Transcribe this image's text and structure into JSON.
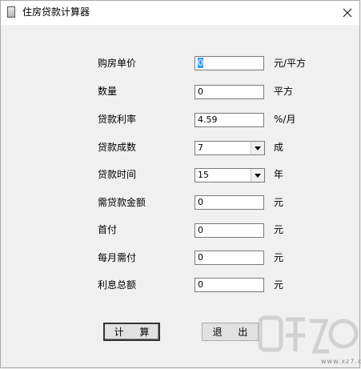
{
  "window": {
    "title": "住房贷款计算器"
  },
  "form": {
    "price": {
      "label": "购房单价",
      "value": "0",
      "unit": "元/平方"
    },
    "quantity": {
      "label": "数量",
      "value": "0",
      "unit": "平方"
    },
    "rate": {
      "label": "贷款利率",
      "value": "4.59",
      "unit": "%/月"
    },
    "ratio": {
      "label": "贷款成数",
      "selected": "7",
      "unit": "成"
    },
    "term": {
      "label": "贷款时间",
      "selected": "15",
      "unit": "年"
    },
    "loan_amount": {
      "label": "需贷款金额",
      "value": "0",
      "unit": "元"
    },
    "down_payment": {
      "label": "首付",
      "value": "0",
      "unit": "元"
    },
    "monthly": {
      "label": "每月需付",
      "value": "0",
      "unit": "元"
    },
    "interest": {
      "label": "利息总额",
      "value": "0",
      "unit": "元"
    }
  },
  "buttons": {
    "calculate": "计 算",
    "exit": "退 出"
  },
  "watermark": {
    "text": "www.xz7.com"
  },
  "icons": {
    "app": "document-icon",
    "close": "close-icon",
    "dropdown": "chevron-down-icon"
  }
}
